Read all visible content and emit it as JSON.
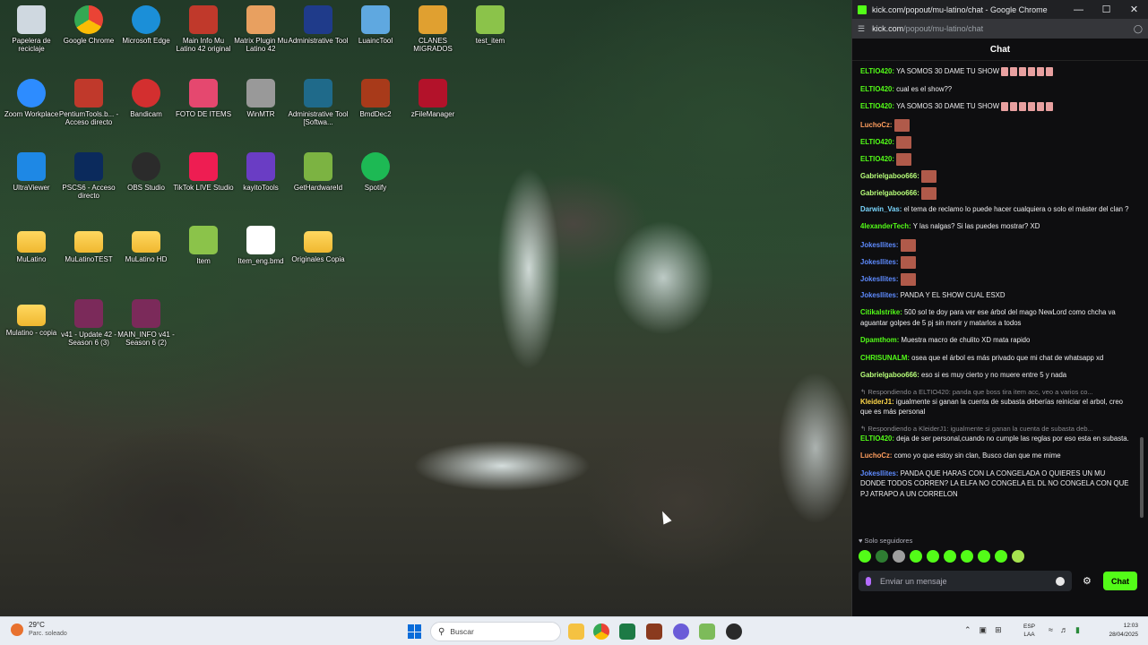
{
  "desktop": {
    "icons": [
      {
        "label": "Papelera de reciclaje",
        "icon": "recycle-bin-icon"
      },
      {
        "label": "Google Chrome",
        "icon": "chrome-icon"
      },
      {
        "label": "Microsoft Edge",
        "icon": "edge-icon"
      },
      {
        "label": "Main Info Mu Latino 42 original",
        "icon": "app-icon"
      },
      {
        "label": "Matrix Plugin Mu Latino 42",
        "icon": "house-icon"
      },
      {
        "label": "Administrative Tool",
        "icon": "moon-icon"
      },
      {
        "label": "LuaincTool",
        "icon": "monitor-icon"
      },
      {
        "label": "CLANES MIGRADOS",
        "icon": "folder-key-icon"
      },
      {
        "label": "test_item",
        "icon": "file-icon"
      },
      {
        "label": "Zoom Workplace",
        "icon": "zoom-icon"
      },
      {
        "label": "PentiumTools.b... - Acceso directo",
        "icon": "tools-icon"
      },
      {
        "label": "Bandicam",
        "icon": "record-icon"
      },
      {
        "label": "FOTO DE ITEMS",
        "icon": "cube-icon"
      },
      {
        "label": "WinMTR",
        "icon": "network-icon"
      },
      {
        "label": "Administrative Tool [Softwa...",
        "icon": "rg-icon"
      },
      {
        "label": "BmdDec2",
        "icon": "gear-icon"
      },
      {
        "label": "zFileManager",
        "icon": "mu-icon"
      },
      {
        "label": "UltraViewer",
        "icon": "ultraviewer-icon"
      },
      {
        "label": "PSCS6 - Acceso directo",
        "icon": "photoshop-icon"
      },
      {
        "label": "OBS Studio",
        "icon": "obs-icon"
      },
      {
        "label": "TikTok LIVE Studio",
        "icon": "tiktok-icon"
      },
      {
        "label": "kayitoTools",
        "icon": "vs-icon"
      },
      {
        "label": "GetHardwareId",
        "icon": "mu-green-icon"
      },
      {
        "label": "Spotify",
        "icon": "spotify-icon"
      },
      {
        "label": "MuLatino",
        "icon": "folder-icon"
      },
      {
        "label": "MuLatinoTEST",
        "icon": "folder-icon"
      },
      {
        "label": "MuLatino HD",
        "icon": "folder-icon"
      },
      {
        "label": "Item",
        "icon": "file-icon"
      },
      {
        "label": "Item_eng.bmd",
        "icon": "document-icon"
      },
      {
        "label": "Originales Copia",
        "icon": "folder-icon"
      },
      {
        "label": "Mulatino - copia",
        "icon": "folder-icon"
      },
      {
        "label": "v41 - Update 42 - Season 6 (3)",
        "icon": "winrar-icon"
      },
      {
        "label": "MAIN_INFO v41 - Season 6 (2)",
        "icon": "winrar-icon"
      }
    ]
  },
  "chat_window": {
    "title": "kick.com/popout/mu-latino/chat - Google Chrome",
    "url_main": "kick.com",
    "url_rest": "/popout/mu-latino/chat",
    "header": "Chat",
    "messages": [
      {
        "user": "ELTIO420",
        "color": "#53fc18",
        "text": "YA SOMOS 30 DAME TU SHOW",
        "emotes": 6
      },
      {
        "user": "ELTIO420",
        "color": "#53fc18",
        "text": "cual es el show??"
      },
      {
        "user": "ELTIO420",
        "color": "#53fc18",
        "text": "YA SOMOS 30 DAME TU SHOW",
        "emotes": 6
      },
      {
        "user": "LuchoCz",
        "color": "#ff9e5e",
        "text": "",
        "big": true
      },
      {
        "user": "ELTIO420",
        "color": "#53fc18",
        "text": "",
        "big": true
      },
      {
        "user": "ELTIO420",
        "color": "#53fc18",
        "text": "",
        "big": true
      },
      {
        "user": "Gabrielgaboo666",
        "color": "#b8ff7a",
        "text": "",
        "big": true
      },
      {
        "user": "Gabrielgaboo666",
        "color": "#b8ff7a",
        "text": "",
        "big": true
      },
      {
        "user": "Darwin_Vas",
        "color": "#7ad7ff",
        "text": "el tema de reclamo lo puede hacer cualquiera o solo el máster del clan ?"
      },
      {
        "user": "4lexanderTech",
        "color": "#53fc18",
        "text": "Y las nalgas? Si las puedes mostrar? XD"
      },
      {
        "user": "Jokesllites",
        "color": "#5e8bff",
        "text": "",
        "big": true
      },
      {
        "user": "Jokesllites",
        "color": "#5e8bff",
        "text": "",
        "big": true
      },
      {
        "user": "Jokesllites",
        "color": "#5e8bff",
        "text": "",
        "big": true
      },
      {
        "user": "Jokesllites",
        "color": "#5e8bff",
        "text": "PANDA Y EL SHOW CUAL ESXD"
      },
      {
        "user": "Citikalstrike",
        "color": "#53fc18",
        "text": "500 sol te doy para ver ese árbol del mago NewLord como chcha va aguantar golpes de 5 pj sin morir y matarlos a todos"
      },
      {
        "user": "Dpamthom",
        "color": "#53fc18",
        "text": "Muestra macro de chulito XD mata rapido"
      },
      {
        "user": "CHRISUNALM",
        "color": "#53fc18",
        "text": "osea que el árbol es más privado que mi chat de whatsapp xd"
      },
      {
        "user": "Gabrielgaboo666",
        "color": "#b8ff7a",
        "text": "eso si es muy cierto y no muere entre 5 y nada"
      },
      {
        "reply": "Respondiendo a ELTIO420: panda que boss tira item acc, veo a varios co...",
        "user": "KleiderJ1",
        "color": "#ffd84a",
        "text": "igualmente si ganan la cuenta de subasta deberías reiniciar el arbol, creo que es más personal"
      },
      {
        "reply": "Respondiendo a KleiderJ1: igualmente si ganan la cuenta de subasta deb...",
        "user": "ELTIO420",
        "color": "#53fc18",
        "text": "deja de ser personal,cuando no cumple las reglas por eso esta en subasta."
      },
      {
        "user": "LuchoCz",
        "color": "#ff9e5e",
        "text": "como yo que estoy sin clan, Busco clan que me mime"
      },
      {
        "user": "Jokesllites",
        "color": "#5e8bff",
        "text": "PANDA QUE HARAS CON LA CONGELADA O QUIERES UN MU DONDE TODOS CORREN? LA ELFA NO CONGELA EL DL NO CONGELA CON QUE PJ ATRAPO A UN CORRELON"
      }
    ],
    "followers_only": "Solo seguidores",
    "input_placeholder": "Enviar un mensaje",
    "send_label": "Chat"
  },
  "taskbar": {
    "weather_temp": "29°C",
    "weather_desc": "Parc. soleado",
    "search_placeholder": "Buscar",
    "lang_line1": "ESP",
    "lang_line2": "LAA",
    "time": "12:03",
    "date": "28/04/2025"
  }
}
